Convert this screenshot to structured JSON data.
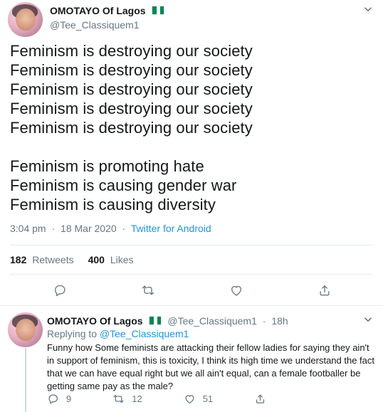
{
  "main_tweet": {
    "author": {
      "name": "OMOTAYO Of Lagos",
      "handle": "@Tee_Classiquem1",
      "flag_icon": "nigeria-flag-icon"
    },
    "text_lines": [
      "Feminism is destroying our society",
      "Feminism is destroying our society",
      "Feminism is destroying our society",
      "Feminism is destroying our society",
      "Feminism is destroying our society",
      "",
      "Feminism is promoting hate",
      "Feminism is causing gender war",
      "Feminism is causing diversity"
    ],
    "timestamp": "3:04 pm · 18 Mar 2020",
    "timestamp_time": "3:04 pm",
    "timestamp_date": "18 Mar 2020",
    "meta_separator": "·",
    "source": "Twitter for Android",
    "stats": {
      "retweets_count": "182",
      "retweets_label": "Retweets",
      "likes_count": "400",
      "likes_label": "Likes"
    },
    "actions": [
      "reply-icon",
      "retweet-icon",
      "like-icon",
      "share-icon"
    ]
  },
  "reply_tweet": {
    "author": {
      "name": "OMOTAYO Of Lagos",
      "handle": "@Tee_Classiquem1",
      "flag_icon": "nigeria-flag-icon"
    },
    "time": "18h",
    "separator": "·",
    "replying_to_label": "Replying to",
    "replying_to_handle": "@Tee_Classiquem1",
    "text": "Funny how Some feminists are attacking their fellow ladies for saying they ain't in support of feminism, this is toxicity, I think its high time we understand the fact that we can have equal right but we all ain't equal, can a female footballer be getting same pay as the male?",
    "actions": {
      "reply_count": "9",
      "retweet_count": "12",
      "like_count": "51"
    }
  },
  "colors": {
    "text_primary": "#14171a",
    "text_secondary": "#657786",
    "link": "#1b95e0",
    "divider": "#e6ecf0",
    "flag_green": "#008751",
    "thread_line": "#ccd6dd"
  }
}
